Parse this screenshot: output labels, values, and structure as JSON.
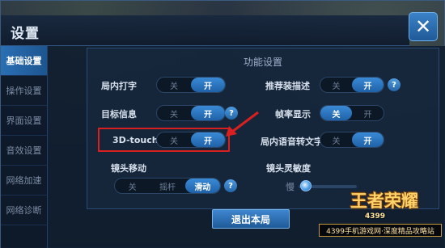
{
  "window": {
    "title": "设置",
    "close_icon": "close-icon"
  },
  "sidebar": {
    "items": [
      {
        "label": "基础设置",
        "active": true
      },
      {
        "label": "操作设置",
        "active": false
      },
      {
        "label": "界面设置",
        "active": false
      },
      {
        "label": "音效设置",
        "active": false
      },
      {
        "label": "网络加速",
        "active": false
      },
      {
        "label": "网络诊断",
        "active": false
      }
    ]
  },
  "panel": {
    "section_title": "功能设置",
    "settings": {
      "in_game_typing": {
        "label": "局内打字",
        "off": "关",
        "on": "开",
        "state": "on",
        "help": false
      },
      "target_info": {
        "label": "目标信息",
        "off": "关",
        "on": "开",
        "state": "on",
        "help": true,
        "help_text": "?"
      },
      "touch_3d": {
        "label": "3D-touch",
        "off": "关",
        "on": "开",
        "state": "on",
        "help": false
      },
      "camera_move": {
        "label": "镜头移动",
        "options": [
          "关",
          "摇杆",
          "滑动"
        ],
        "selected": "滑动",
        "help": true,
        "help_text": "?"
      },
      "recommend_desc": {
        "label": "推荐装描述",
        "off": "关",
        "on": "开",
        "state": "on",
        "help": true,
        "help_text": "?"
      },
      "frame_rate": {
        "label": "帧率显示",
        "off": "关",
        "on": "开",
        "state": "off",
        "help": false
      },
      "voice_to_text": {
        "label": "局内语音转文字",
        "off": "关",
        "on": "开",
        "state": "on",
        "help": false
      },
      "camera_sensitivity": {
        "label": "镜头灵敏度",
        "min_label": "慢",
        "level": 0.12
      }
    }
  },
  "footer": {
    "exit_label": "退出本局"
  },
  "branding": {
    "logo_text": "王者荣耀",
    "logo_sub": "4399",
    "watermark": "4399手机游戏网·深度精品攻略站"
  },
  "colors": {
    "accent": "#2f7ac4",
    "highlight_box": "#d82020"
  }
}
